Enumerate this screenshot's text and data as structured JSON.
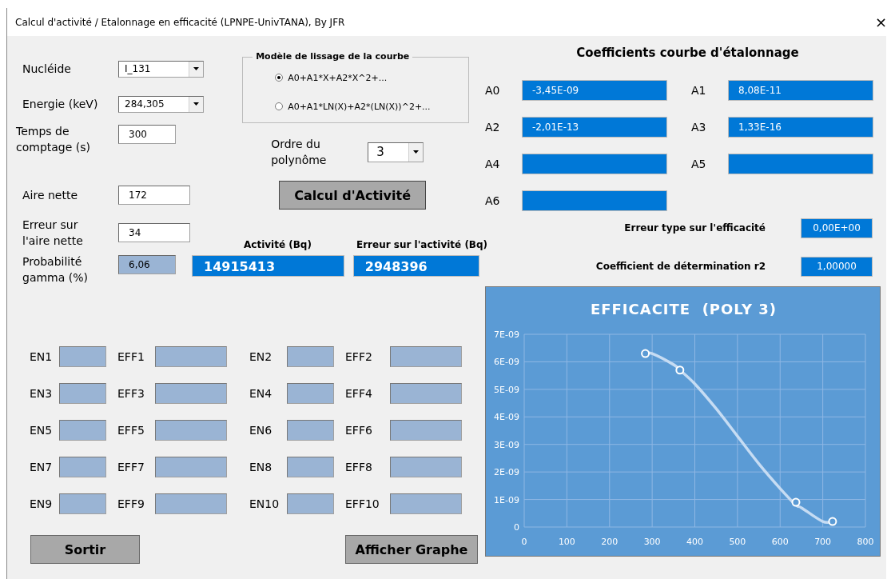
{
  "window": {
    "title": "Calcul d'activité / Etalonnage en efficacité  (LPNPE-UnivTANA), By JFR",
    "close": "×"
  },
  "nuclide": {
    "label": "Nucléide",
    "value": "I_131"
  },
  "energy": {
    "label": "Energie (keV)",
    "value": "284,305"
  },
  "count_time": {
    "label": "Temps de comptage (s)",
    "value": "300"
  },
  "fit_model": {
    "title": "Modèle de lissage de la courbe",
    "options": [
      {
        "label": "A0+A1*X+A2*X^2+...",
        "selected": true
      },
      {
        "label": "A0+A1*LN(X)+A2*(LN(X))^2+...",
        "selected": false
      }
    ]
  },
  "poly_order": {
    "label": "Ordre du polynôme",
    "value": "3"
  },
  "net_area": {
    "label": "Aire nette",
    "value": "172"
  },
  "calc_button": "Calcul d'Activité",
  "net_area_error": {
    "label": "Erreur sur l'aire nette",
    "value": "34"
  },
  "activity": {
    "label": "Activité (Bq)",
    "value": "14915413"
  },
  "activity_error": {
    "label": "Erreur sur l'activité (Bq)",
    "value": "2948396"
  },
  "gamma_prob": {
    "label": "Probabilité gamma (%)",
    "value": "6,06"
  },
  "coefficients": {
    "title": "Coefficients courbe d'étalonnage",
    "items": [
      {
        "label": "A0",
        "value": "-3,45E-09"
      },
      {
        "label": "A1",
        "value": "8,08E-11"
      },
      {
        "label": "A2",
        "value": "-2,01E-13"
      },
      {
        "label": "A3",
        "value": "1,33E-16"
      },
      {
        "label": "A4"
      },
      {
        "label": "A5"
      },
      {
        "label": "A6"
      }
    ]
  },
  "std_error": {
    "label": "Erreur type sur l'efficacité",
    "value": "0,00E+00"
  },
  "r2": {
    "label": "Coefficient de détermination r2",
    "value": "1,00000"
  },
  "chart": {
    "chart_data": {
      "type": "scatter",
      "title": "EFFICACITE  (POLY 3)",
      "x": [
        284,
        300,
        350,
        365,
        400,
        450,
        500,
        550,
        600,
        637,
        650,
        700,
        723
      ],
      "series": [
        {
          "type": "scatter",
          "color": "#ffffff",
          "values": [
            6.3e-09,
            null,
            null,
            5.7e-09,
            null,
            null,
            null,
            null,
            null,
            9e-10,
            null,
            null,
            2e-10
          ]
        },
        {
          "type": "line",
          "color": "#c6dcf3",
          "values": [
            6.3e-09,
            6.3e-09,
            5.9e-09,
            5.7e-09,
            5.2e-09,
            4.3e-09,
            3.3e-09,
            2.3e-09,
            1.4e-09,
            8e-10,
            7e-10,
            2e-10,
            2e-10
          ]
        }
      ],
      "grid": true,
      "xlim": [
        0,
        800
      ],
      "ylim": [
        0,
        7e-09
      ],
      "xticks": [
        0,
        100,
        200,
        300,
        400,
        500,
        600,
        700,
        800
      ],
      "yticks": [
        0,
        {
          "value": 1e-09,
          "label": "1E-09"
        },
        {
          "value": 2e-09,
          "label": "2E-09"
        },
        {
          "value": 3e-09,
          "label": "3E-09"
        },
        {
          "value": 4e-09,
          "label": "4E-09"
        },
        {
          "value": 5e-09,
          "label": "5E-09"
        },
        {
          "value": 6e-09,
          "label": "6E-09"
        },
        {
          "value": 7e-09,
          "label": "7E-09"
        }
      ]
    }
  },
  "calibration_points": [
    {
      "en_label": "EN1",
      "eff_label": "EFF1"
    },
    {
      "en_label": "EN2",
      "eff_label": "EFF2"
    },
    {
      "en_label": "EN3",
      "eff_label": "EFF3"
    },
    {
      "en_label": "EN4",
      "eff_label": "EFF4"
    },
    {
      "en_label": "EN5",
      "eff_label": "EFF5"
    },
    {
      "en_label": "EN6",
      "eff_label": "EFF6"
    },
    {
      "en_label": "EN7",
      "eff_label": "EFF7"
    },
    {
      "en_label": "EN8",
      "eff_label": "EFF8"
    },
    {
      "en_label": "EN9",
      "eff_label": "EFF9"
    },
    {
      "en_label": "EN10",
      "eff_label": "EFF10"
    }
  ],
  "buttons": [
    "Sortir",
    "Afficher Graphe"
  ]
}
